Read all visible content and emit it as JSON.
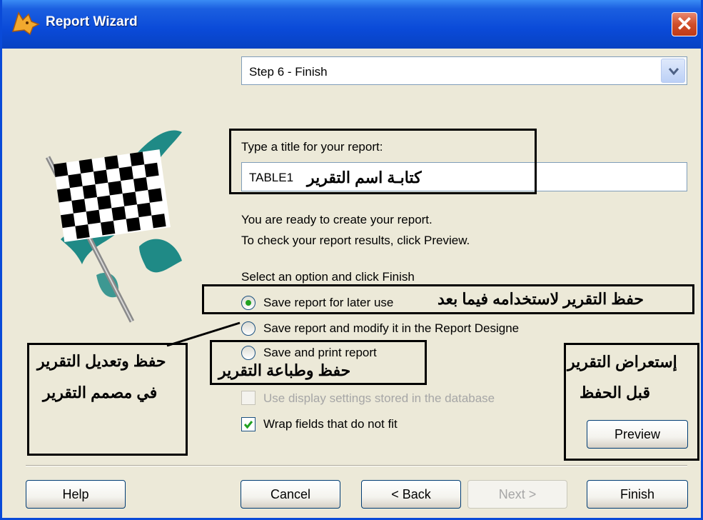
{
  "window": {
    "title": "Report Wizard",
    "close_glyph": "✕"
  },
  "step_select": {
    "value": "Step 6 - Finish"
  },
  "title_field": {
    "label": "Type a title for your report:",
    "value": "TABLE1"
  },
  "info": {
    "line1": "You are ready to create your report.",
    "line2": "To check your report results, click Preview."
  },
  "options": {
    "header": "Select an option and click Finish",
    "save_later": "Save report for later use",
    "save_modify": "Save report and modify it in the Report Designe",
    "save_print": "Save and print report",
    "selected": "save_later"
  },
  "checkboxes": {
    "display_settings": {
      "label": "Use display settings stored in the database",
      "checked": false,
      "disabled": true
    },
    "wrap_fields": {
      "label": "Wrap fields that do not fit",
      "checked": true
    }
  },
  "annotations": {
    "title_name": "كتابـة اسم التقرير",
    "save_later": "حفظ التقرير لاستخدامه فيما بعد",
    "modify_line1": "حفظ وتعديل التقرير",
    "modify_line2": "في مصمم التقرير",
    "save_print": "حفظ وطباعة التقرير",
    "preview_line1": "إستعراض التقرير",
    "preview_line2": "قبل الحفظ"
  },
  "buttons": {
    "preview": "Preview",
    "help": "Help",
    "cancel": "Cancel",
    "back": "< Back",
    "next": "Next >",
    "finish": "Finish"
  },
  "colors": {
    "titlebar": "#0a4ad8",
    "dialog_bg": "#ece9d8",
    "flag_teal": "#1f8a86"
  },
  "icons": [
    "fox-icon",
    "close-icon",
    "dropdown-arrow-icon",
    "checkered-flag-image"
  ]
}
